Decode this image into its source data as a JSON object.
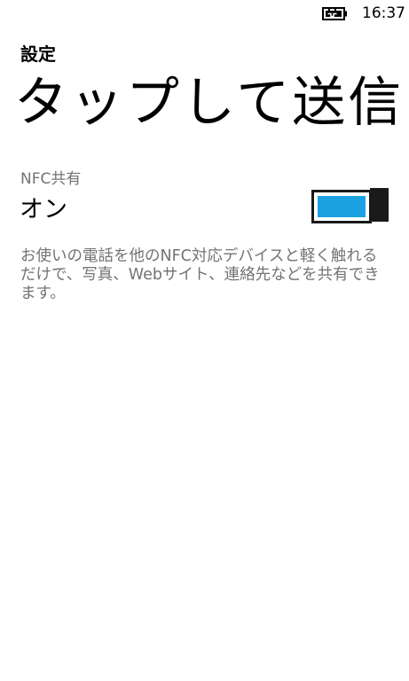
{
  "status_bar": {
    "battery_icon": "battery-charging-icon",
    "time": "16:37"
  },
  "header": {
    "app_title": "設定",
    "page_title": "タップして送信"
  },
  "nfc_setting": {
    "label": "NFC共有",
    "state": "オン",
    "toggle_on": true,
    "accent_color": "#1ba1e2"
  },
  "description": "お使いの電話を他のNFC対応デバイスと軽く触れるだけで、写真、Webサイト、連絡先などを共有できます。"
}
